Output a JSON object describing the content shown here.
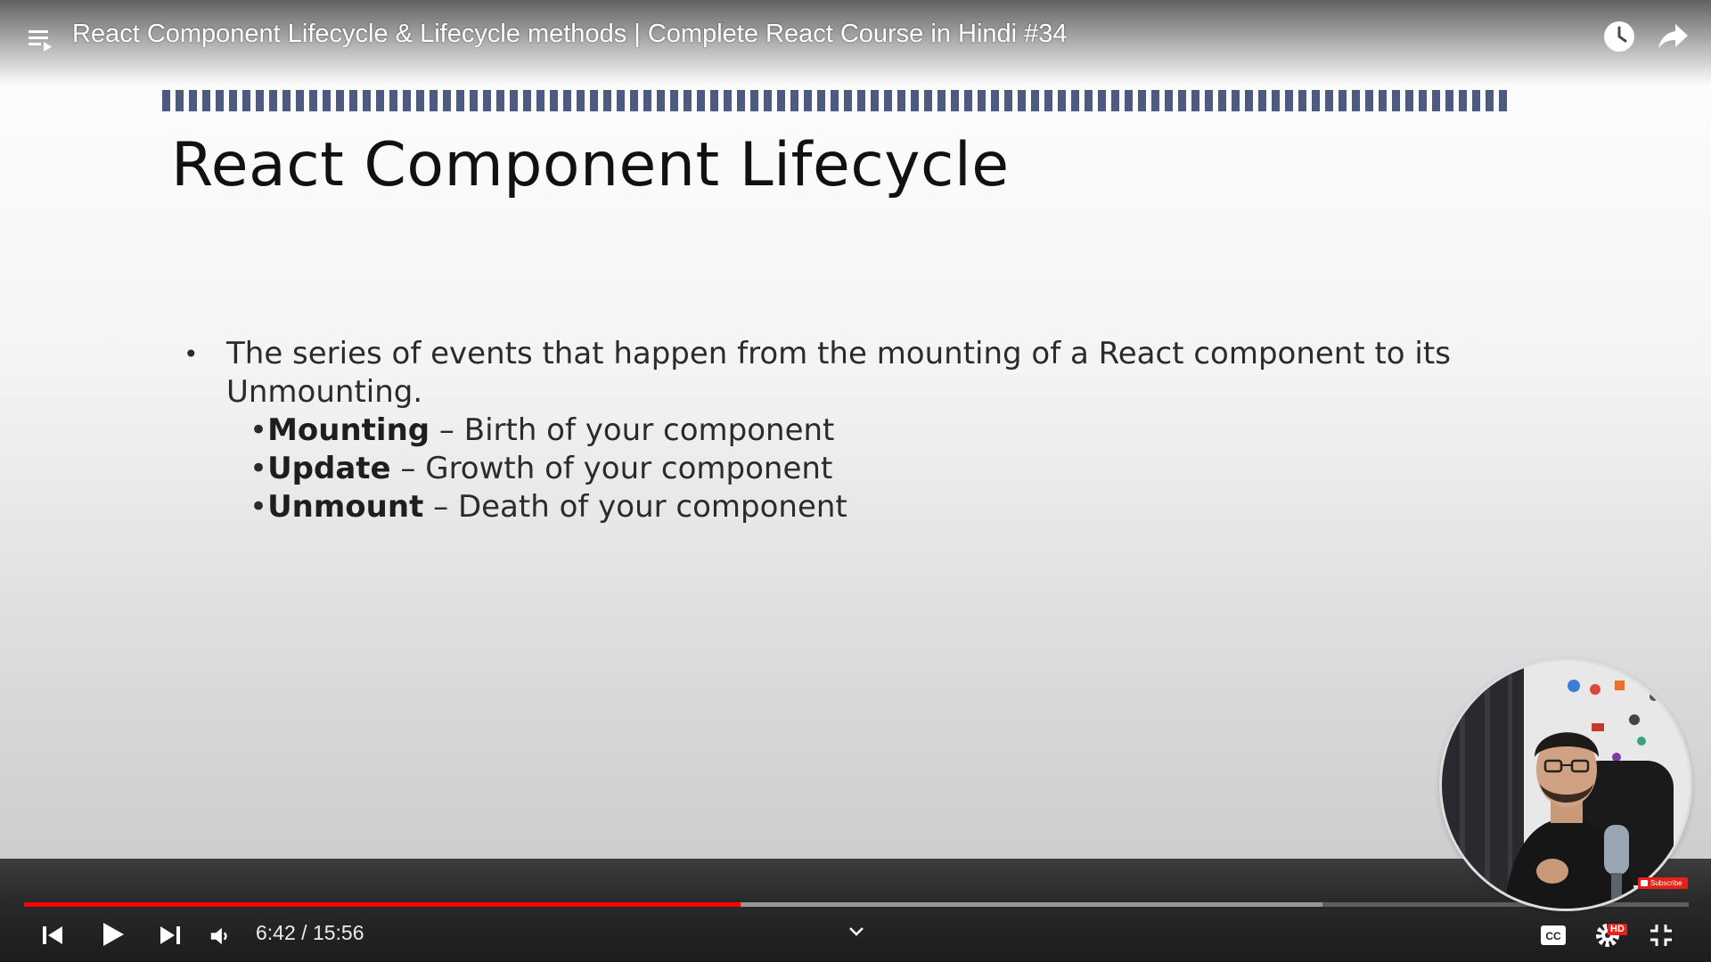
{
  "player": {
    "title": "React Component Lifecycle & Lifecycle methods | Complete React Course in Hindi #34",
    "time_current": "6:42",
    "time_total": "15:56",
    "time_separator": " / ",
    "progress_fraction": 0.4306,
    "buffered_fraction": 0.78,
    "hd_badge": "HD",
    "subscribe_label": "Subscribe",
    "accent_color": "#ff0000"
  },
  "slide": {
    "title": "React Component Lifecycle",
    "bullet_text": "The series of events that happen from the mounting of a React component to its Unmounting.",
    "bullet_marker": "•",
    "sub_items": [
      {
        "term": "Mounting",
        "desc": " – Birth of your component"
      },
      {
        "term": "Update",
        "desc": " – Growth of your component"
      },
      {
        "term": "Unmount",
        "desc": " – Death of your component"
      }
    ]
  },
  "icons": {
    "top_left": "playlist-icon",
    "top_right": [
      "watch-later-icon",
      "share-icon"
    ],
    "controls_left": [
      "previous-icon",
      "play-icon",
      "next-icon",
      "volume-icon"
    ],
    "controls_center": "chevron-down-icon",
    "controls_right": [
      "captions-icon",
      "settings-icon",
      "exit-fullscreen-icon"
    ]
  }
}
